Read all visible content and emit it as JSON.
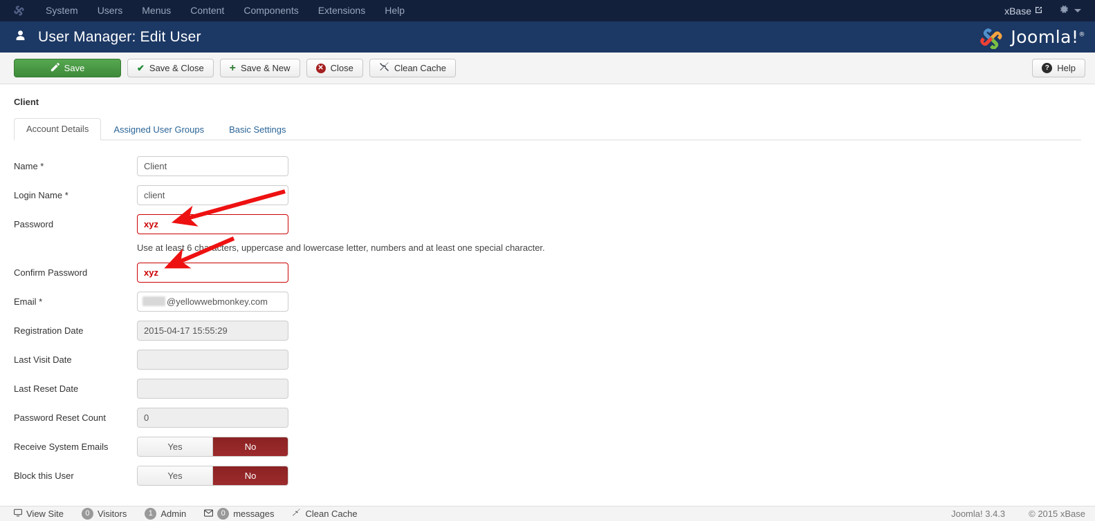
{
  "topbar": {
    "brand_icon": "joomla-logo-icon",
    "menu": [
      {
        "label": "System"
      },
      {
        "label": "Users"
      },
      {
        "label": "Menus"
      },
      {
        "label": "Content"
      },
      {
        "label": "Components"
      },
      {
        "label": "Extensions"
      },
      {
        "label": "Help"
      }
    ],
    "site_name": "xBase",
    "external_link_icon": "⧉",
    "gear_icon": "⚙"
  },
  "header": {
    "user_icon": "὆4",
    "title": "User Manager: Edit User",
    "logo_text": "Joomla!",
    "logo_sup": "®"
  },
  "toolbar": {
    "save_label": "Save",
    "save_close_label": "Save & Close",
    "save_new_label": "Save & New",
    "close_label": "Close",
    "clean_cache_label": "Clean Cache",
    "help_label": "Help",
    "save_icon": "✎",
    "check_icon": "✔",
    "plus_icon": "＋",
    "close_icon": "✕",
    "broom_icon": "✖",
    "help_icon": "?"
  },
  "content": {
    "section_title": "Client",
    "tabs": [
      {
        "label": "Account Details",
        "active": true
      },
      {
        "label": "Assigned User Groups",
        "active": false
      },
      {
        "label": "Basic Settings",
        "active": false
      }
    ],
    "fields": [
      {
        "label": "Name *",
        "value": "Client"
      },
      {
        "label": "Login Name *",
        "value": "client"
      },
      {
        "label": "Password",
        "value": "xyz"
      },
      {
        "label": "Confirm Password",
        "value": "xyz"
      },
      {
        "label": "Email *",
        "value": "@yellowwebmonkey.com"
      },
      {
        "label": "Registration Date",
        "value": "2015-04-17 15:55:29"
      },
      {
        "label": "Last Visit Date",
        "value": ""
      },
      {
        "label": "Last Reset Date",
        "value": ""
      },
      {
        "label": "Password Reset Count",
        "value": "0"
      },
      {
        "label": "Receive System Emails",
        "value": "No"
      },
      {
        "label": "Block this User",
        "value": "No"
      }
    ],
    "password_hint": "Use at least 6 characters, uppercase and lowercase letter, numbers and at least one special character.",
    "toggle_yes": "Yes",
    "toggle_no": "No"
  },
  "footer": {
    "view_site": "View Site",
    "visitors_count": "0",
    "visitors_label": "Visitors",
    "admin_count": "1",
    "admin_label": "Admin",
    "messages_count": "0",
    "messages_label": "messages",
    "clean_cache": "Clean Cache",
    "version": "Joomla! 3.4.3",
    "copyright": "© 2015 xBase"
  },
  "colors": {
    "topbar_bg": "#13203c",
    "header_bg": "#1c3864",
    "save_green": "#3e8a3a",
    "toggle_red": "#8b2223",
    "invalid_red": "#cc0000",
    "annotation_red": "#ee1111",
    "link_blue": "#2a6496"
  }
}
